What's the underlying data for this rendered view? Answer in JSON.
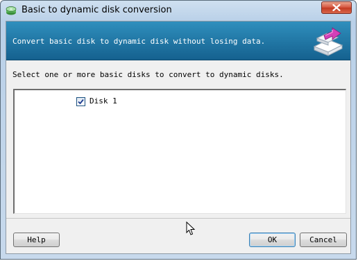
{
  "window": {
    "title": "Basic to dynamic disk conversion",
    "app_icon": "disk-manager-icon",
    "close_icon": "close-icon"
  },
  "banner": {
    "text": "Convert basic disk to dynamic disk without losing data.",
    "icon": "disk-convert-icon"
  },
  "main": {
    "instruction": "Select one or more basic disks to convert to dynamic disks.",
    "disks": [
      {
        "label": "Disk 1",
        "checked": true
      }
    ]
  },
  "buttons": {
    "help": "Help",
    "ok": "OK",
    "cancel": "Cancel"
  },
  "colors": {
    "banner_start": "#2f8fbd",
    "banner_end": "#15618f",
    "close_button": "#c23a22"
  }
}
